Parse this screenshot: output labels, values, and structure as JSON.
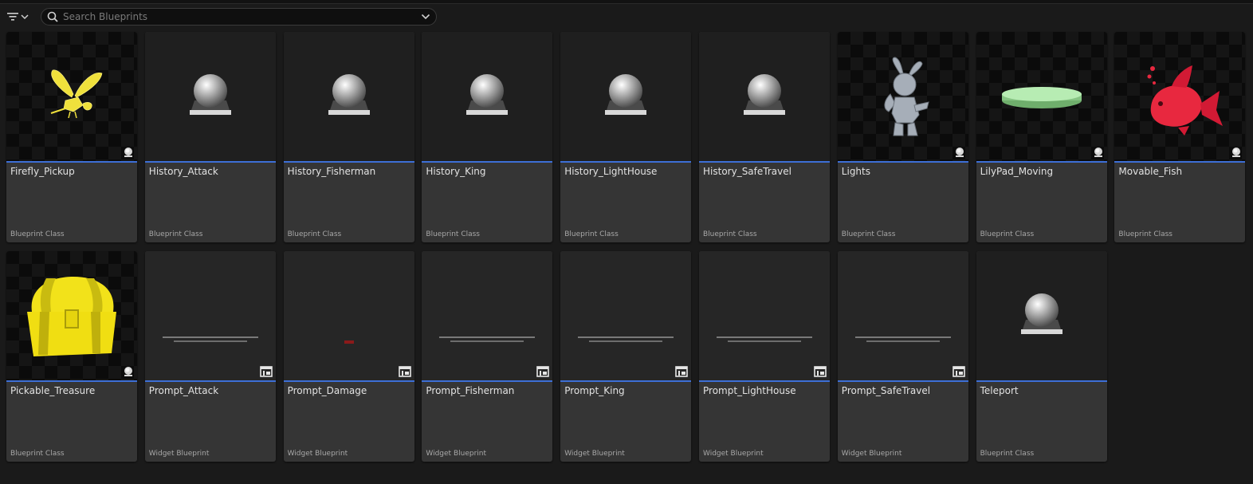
{
  "search": {
    "placeholder": "Search Blueprints"
  },
  "icons": {
    "filter": "filter-icon",
    "chevron": "chevron-down-icon",
    "search": "search-icon",
    "sphere": "sphere-icon",
    "widget": "widget-icon"
  },
  "colors": {
    "accent": "#3d6fd6",
    "firefly": "#f0e13c",
    "treasure": "#f2e21a",
    "lilypad": "#9fdc9c",
    "fish": "#e8283f"
  },
  "assets": [
    {
      "name": "Firefly_Pickup",
      "type": "Blueprint Class"
    },
    {
      "name": "History_Attack",
      "type": "Blueprint Class"
    },
    {
      "name": "History_Fisherman",
      "type": "Blueprint Class"
    },
    {
      "name": "History_King",
      "type": "Blueprint Class"
    },
    {
      "name": "History_LightHouse",
      "type": "Blueprint Class"
    },
    {
      "name": "History_SafeTravel",
      "type": "Blueprint Class"
    },
    {
      "name": "Lights",
      "type": "Blueprint Class"
    },
    {
      "name": "LilyPad_Moving",
      "type": "Blueprint Class"
    },
    {
      "name": "Movable_Fish",
      "type": "Blueprint Class"
    },
    {
      "name": "Pickable_Treasure",
      "type": "Blueprint Class"
    },
    {
      "name": "Prompt_Attack",
      "type": "Widget Blueprint"
    },
    {
      "name": "Prompt_Damage",
      "type": "Widget Blueprint"
    },
    {
      "name": "Prompt_Fisherman",
      "type": "Widget Blueprint"
    },
    {
      "name": "Prompt_King",
      "type": "Widget Blueprint"
    },
    {
      "name": "Prompt_LightHouse",
      "type": "Widget Blueprint"
    },
    {
      "name": "Prompt_SafeTravel",
      "type": "Widget Blueprint"
    },
    {
      "name": "Teleport",
      "type": "Blueprint Class"
    }
  ]
}
